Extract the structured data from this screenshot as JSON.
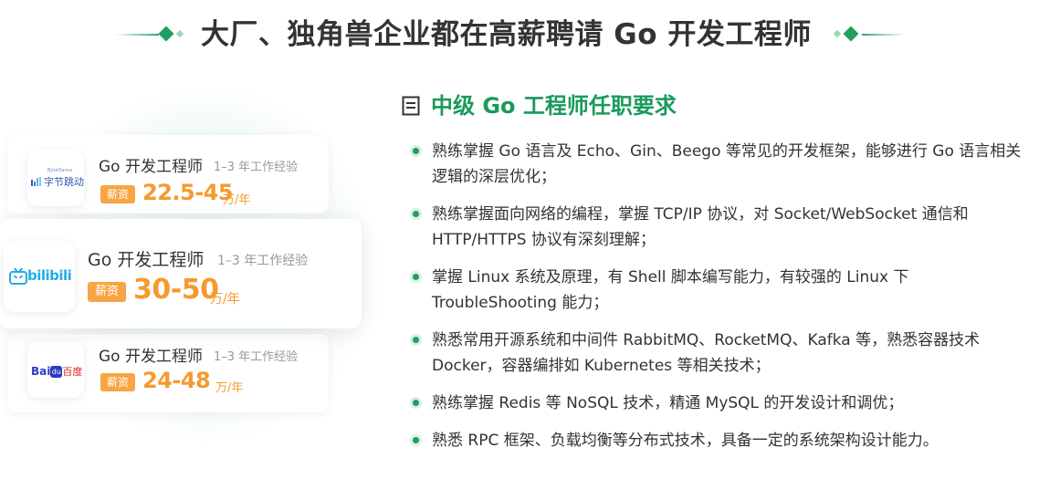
{
  "header": {
    "title": "大厂、独角兽企业都在高薪聘请 Go 开发工程师",
    "accent_color": "#1fa05e"
  },
  "jobs": [
    {
      "company_logo": "bytedance-logo",
      "logo_text_small": "ByteDance",
      "logo_text": "字节跳动",
      "title": "Go 开发工程师",
      "experience": "1–3 年工作经验",
      "salary_tag": "薪资",
      "salary_range": "22.5-45",
      "salary_unit": "万/年"
    },
    {
      "company_logo": "bilibili-logo",
      "logo_text": "bilibili",
      "title": "Go 开发工程师",
      "experience": "1–3 年工作经验",
      "salary_tag": "薪资",
      "salary_range": "30-50",
      "salary_unit": "万/年"
    },
    {
      "company_logo": "baidu-logo",
      "logo_text": "Bai",
      "logo_text_paw": "du",
      "logo_text_cn": "百度",
      "title": "Go 开发工程师",
      "experience": "1–3 年工作经验",
      "salary_tag": "薪资",
      "salary_range": "24-48",
      "salary_unit": "万/年"
    }
  ],
  "requirements": {
    "title": "中级 Go 工程师任职要求",
    "items": [
      "熟练掌握 Go 语言及 Echo、Gin、Beego 等常见的开发框架，能够进行 Go 语言相关逻辑的深层优化；",
      "熟练掌握面向网络的编程，掌握 TCP/IP 协议，对 Socket/WebSocket 通信和 HTTP/HTTPS 协议有深刻理解；",
      "掌握 Linux 系统及原理，有 Shell 脚本编写能力，有较强的 Linux 下 TroubleShooting 能力；",
      "熟悉常用开源系统和中间件 RabbitMQ、RocketMQ、Kafka 等，熟悉容器技术 Docker，容器编排如 Kubernetes 等相关技术；",
      "熟练掌握 Redis 等 NoSQL 技术，精通 MySQL 的开发设计和调优；",
      "熟悉 RPC 框架、负载均衡等分布式技术，具备一定的系统架构设计能力。"
    ]
  },
  "colors": {
    "salary": "#f59a2f",
    "salary_tag_bg": "#f7a543",
    "green": "#1fa05e"
  }
}
